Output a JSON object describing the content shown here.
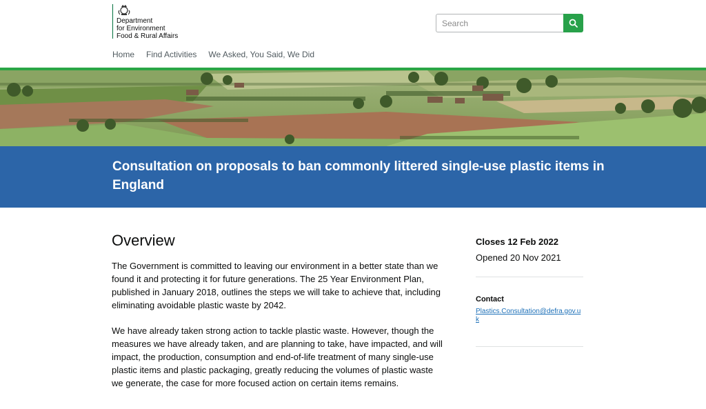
{
  "header": {
    "logo_lines": [
      "Department",
      "for Environment",
      "Food & Rural Affairs"
    ],
    "search_placeholder": "Search"
  },
  "nav": {
    "items": [
      "Home",
      "Find Activities",
      "We Asked, You Said, We Did"
    ]
  },
  "hero": {
    "title": "Consultation on proposals to ban commonly littered single-use plastic items in England"
  },
  "main": {
    "heading": "Overview",
    "paragraphs": [
      "The Government is committed to leaving our environment in a better state than we found it and protecting it for future generations. The 25 Year Environment Plan, published in January 2018, outlines the steps we will take to achieve that, including eliminating avoidable plastic waste by 2042.",
      "We have already taken strong action to tackle plastic waste. However, though the measures we have already taken, and are planning to take, have impacted, and will impact, the production, consumption and end-of-life treatment of many single-use plastic items and plastic packaging, greatly reducing the volumes of plastic waste we generate, the case for more focused action on certain items remains."
    ]
  },
  "sidebar": {
    "closes": "Closes 12 Feb 2022",
    "opened": "Opened 20 Nov 2021",
    "contact_heading": "Contact",
    "contact_email": "Plastics.Consultation@defra.gov.uk"
  },
  "colors": {
    "accent_green": "#2aa545",
    "title_band_blue": "#2c65a8",
    "link_blue": "#1d70b8"
  }
}
